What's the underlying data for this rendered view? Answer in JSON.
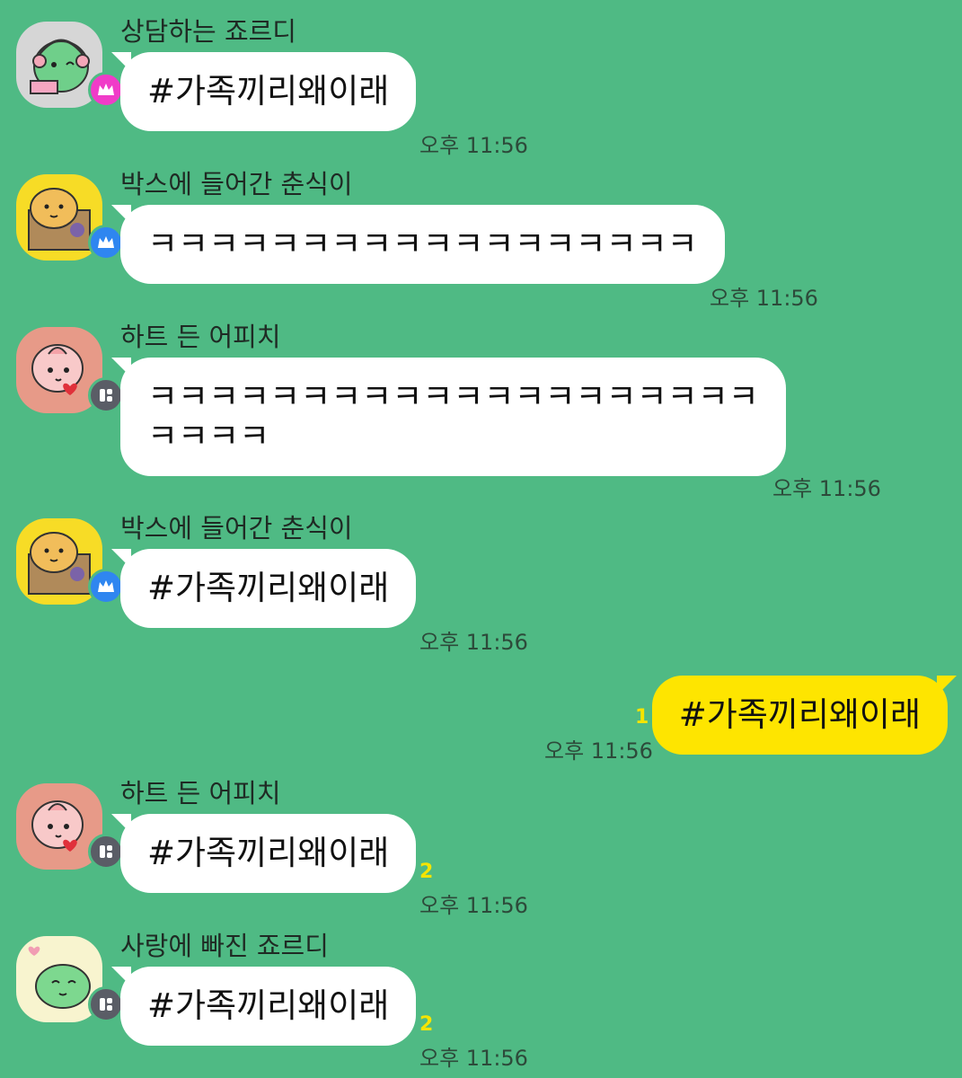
{
  "colors": {
    "background": "#4fba84",
    "mine_bubble": "#fee500",
    "other_bubble": "#ffffff",
    "read_count": "#f5e400"
  },
  "messages": [
    {
      "sender": "상담하는 죠르디",
      "text": "#가족끼리왜이래",
      "time": "오후 11:56",
      "avatar": "jordy-headset-icon",
      "badge": "pink-crown-badge-icon"
    },
    {
      "sender": "박스에 들어간 춘식이",
      "text": "ㅋㅋㅋㅋㅋㅋㅋㅋㅋㅋㅋㅋㅋㅋㅋㅋㅋㅋ",
      "time": "오후 11:56",
      "avatar": "choonsik-box-icon",
      "badge": "blue-crown-badge-icon"
    },
    {
      "sender": "하트 든 어피치",
      "text_line1": "ㅋㅋㅋㅋㅋㅋㅋㅋㅋㅋㅋㅋㅋㅋㅋㅋㅋㅋㅋㅋ",
      "text_line2": "ㅋㅋㅋㅋ",
      "time": "오후 11:56",
      "avatar": "apeach-heart-icon",
      "badge": "member-badge-icon"
    },
    {
      "sender": "박스에 들어간 춘식이",
      "text": "#가족끼리왜이래",
      "time": "오후 11:56",
      "avatar": "choonsik-box-icon",
      "badge": "blue-crown-badge-icon"
    },
    {
      "mine": true,
      "text": "#가족끼리왜이래",
      "time": "오후 11:56",
      "read_count": "1"
    },
    {
      "sender": "하트 든 어피치",
      "text": "#가족끼리왜이래",
      "time": "오후 11:56",
      "read_count": "2",
      "avatar": "apeach-heart-icon",
      "badge": "member-badge-icon"
    },
    {
      "sender": "사랑에 빠진 죠르디",
      "text": "#가족끼리왜이래",
      "time": "오후 11:56",
      "read_count": "2",
      "avatar": "jordy-love-icon",
      "badge": "member-badge-icon"
    }
  ]
}
